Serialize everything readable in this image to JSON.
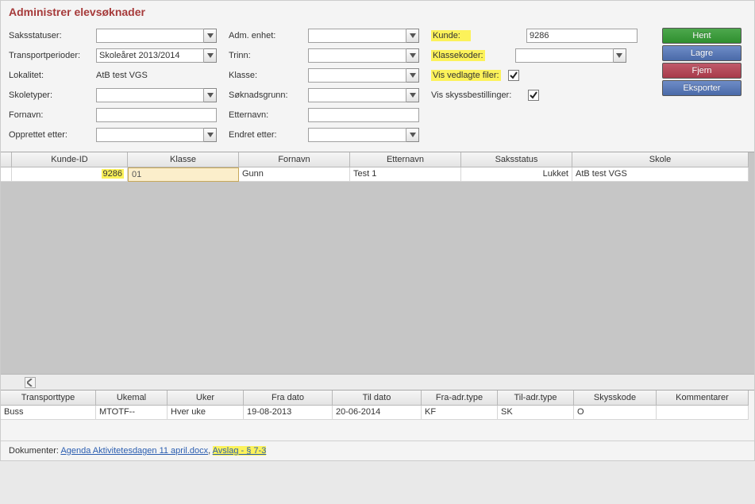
{
  "title": "Administrer elevsøknader",
  "filters": {
    "saksstatuser": {
      "label": "Saksstatuser:",
      "value": ""
    },
    "transportperioder": {
      "label": "Transportperioder:",
      "value": "Skoleåret 2013/2014"
    },
    "lokalitet": {
      "label": "Lokalitet:",
      "value": "AtB test VGS"
    },
    "skoletyper": {
      "label": "Skoletyper:",
      "value": ""
    },
    "fornavn": {
      "label": "Fornavn:",
      "value": ""
    },
    "opprettet_etter": {
      "label": "Opprettet etter:",
      "value": ""
    },
    "adm_enhet": {
      "label": "Adm. enhet:",
      "value": ""
    },
    "trinn": {
      "label": "Trinn:",
      "value": ""
    },
    "klasse": {
      "label": "Klasse:",
      "value": ""
    },
    "soknadsgrunn": {
      "label": "Søknadsgrunn:",
      "value": ""
    },
    "etternavn": {
      "label": "Etternavn:",
      "value": ""
    },
    "endret_etter": {
      "label": "Endret etter:",
      "value": ""
    },
    "kunde": {
      "label": "Kunde:",
      "value": "9286"
    },
    "klassekoder": {
      "label": "Klassekoder:",
      "value": ""
    },
    "vis_vedlagte_filer": {
      "label": "Vis vedlagte filer:",
      "checked": true
    },
    "vis_skyssbestillinger": {
      "label": "Vis skyssbestillinger:",
      "checked": true
    }
  },
  "buttons": {
    "hent": "Hent",
    "lagre": "Lagre",
    "fjern": "Fjern",
    "eksporter": "Eksporter"
  },
  "grid1": {
    "columns": [
      "",
      "Kunde-ID",
      "Klasse",
      "Fornavn",
      "Etternavn",
      "Saksstatus",
      "Skole"
    ],
    "rows": [
      {
        "kunde_id": "9286",
        "klasse": "01",
        "fornavn": "Gunn",
        "etternavn": "Test 1",
        "saksstatus": "Lukket",
        "skole": "AtB test VGS"
      }
    ]
  },
  "grid2": {
    "columns": [
      "Transporttype",
      "Ukemal",
      "Uker",
      "Fra dato",
      "Til dato",
      "Fra-adr.type",
      "Til-adr.type",
      "Skysskode",
      "Kommentarer"
    ],
    "rows": [
      {
        "transporttype": "Buss",
        "ukemal": "MTOTF--",
        "uker": "Hver uke",
        "fra_dato": "19-08-2013",
        "til_dato": "20-06-2014",
        "fra_adr": "KF",
        "til_adr": "SK",
        "skysskode": "O",
        "kommentarer": ""
      }
    ]
  },
  "documents": {
    "label": "Dokumenter:",
    "items": [
      {
        "text": "Agenda Aktivitetesdagen 11 april.docx",
        "highlighted": false
      },
      {
        "text": "Avslag - § 7-3",
        "highlighted": true
      }
    ],
    "separator": ", "
  }
}
